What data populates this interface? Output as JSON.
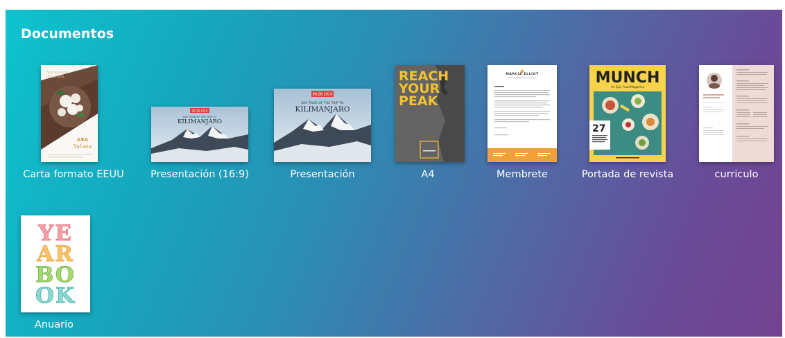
{
  "section": {
    "title": "Documentos"
  },
  "templates": [
    {
      "label": "Carta formato EEUU"
    },
    {
      "label": "Presentación (16:9)"
    },
    {
      "label": "Presentación"
    },
    {
      "label": "A4"
    },
    {
      "label": "Membrete"
    },
    {
      "label": "Portada de revista"
    },
    {
      "label": "curriculo"
    },
    {
      "label": "Anuario"
    }
  ],
  "thumb_text": {
    "letter_brand": "Yafana",
    "pres169_date": "09.28.2014",
    "pres169_sub": "DAY TOUR OF THE TRIP TO",
    "pres169_title": "KILIMANJARO",
    "pres_date": "09.28.2014",
    "pres_sub": "DAY TOUR OF THE TRIP TO",
    "pres_title": "KILIMANJARO",
    "a4_line1": "REACH",
    "a4_line2": "YOUR",
    "a4_line3": "PEAK",
    "letterhead_name": "MARCIA ELLIOT",
    "mag_title": "MUNCH",
    "mag_sub": "An Epic Food Magazine",
    "mag_num": "27",
    "yb_1": "YE",
    "yb_2": "AR",
    "yb_3": "BO",
    "yb_4": "OK"
  },
  "colors": {
    "bg_start": "#0ec3cf",
    "bg_end": "#73428f",
    "a4_yellow": "#f2c230",
    "mag_yellow": "#f7d34a",
    "pres_red": "#d9463e"
  }
}
